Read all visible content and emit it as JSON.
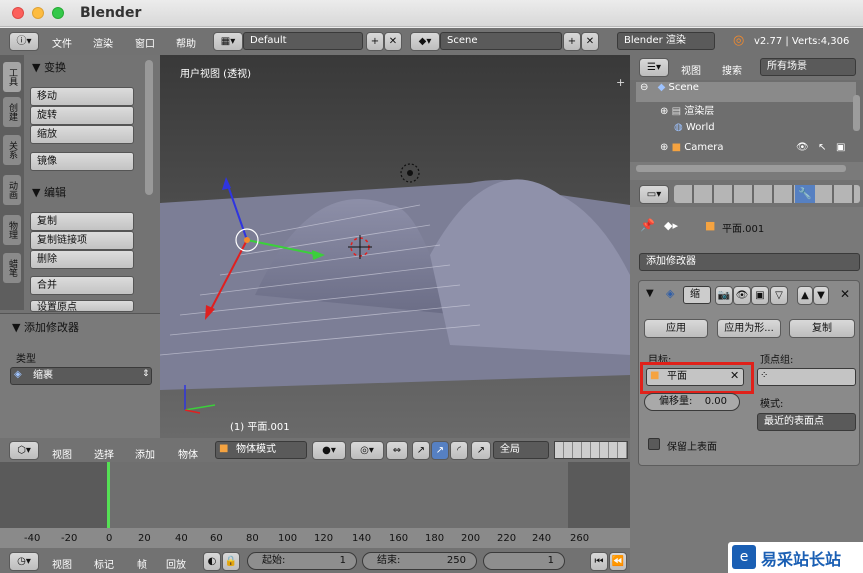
{
  "window": {
    "title": "Blender"
  },
  "top_bar": {
    "menus": [
      "文件",
      "渲染",
      "窗口",
      "帮助"
    ],
    "layout_name": "Default",
    "scene_name": "Scene",
    "render_engine": "Blender 渲染",
    "version_info": "v2.77 | Verts:4,306"
  },
  "tool_shelf": {
    "tabs": [
      "工具",
      "创建",
      "关系",
      "动画",
      "物理",
      "蜡笔"
    ],
    "transform_header": "▼ 变换",
    "transform_buttons": [
      "移动",
      "旋转",
      "缩放",
      "镜像"
    ],
    "edit_header": "▼ 编辑",
    "edit_buttons": [
      "复制",
      "复制链接项",
      "删除",
      "合并",
      "设置原点"
    ]
  },
  "operator_panel": {
    "header": "▼ 添加修改器",
    "type_label": "类型",
    "type_value": "缩裹"
  },
  "viewport": {
    "view_label": "用户视图 (透视)",
    "object_label": "(1) 平面.001"
  },
  "view3d_header": {
    "menus": [
      "视图",
      "选择",
      "添加",
      "物体"
    ],
    "mode": "物体模式",
    "orientation": "全局"
  },
  "timeline": {
    "ticks": [
      "-40",
      "-20",
      "0",
      "20",
      "40",
      "60",
      "80",
      "100",
      "120",
      "140",
      "160",
      "180",
      "200",
      "220",
      "240",
      "260"
    ],
    "current_frame_marker": 0
  },
  "timeline_header": {
    "menus": [
      "视图",
      "标记",
      "帧",
      "回放"
    ],
    "start_label": "起始:",
    "start_value": "1",
    "end_label": "结束:",
    "end_value": "250",
    "current_value": "1"
  },
  "outliner": {
    "menus": [
      "视图",
      "搜索"
    ],
    "filter": "所有场景",
    "items": [
      {
        "label": "Scene"
      },
      {
        "label": "渲染层"
      },
      {
        "label": "World"
      },
      {
        "label": "Camera"
      }
    ]
  },
  "properties": {
    "context_object": "平面.001",
    "add_modifier": "添加修改器",
    "modifier_name": "缩",
    "apply_btn": "应用",
    "apply_as_shape_btn": "应用为形...",
    "copy_btn": "复制",
    "target_label": "目标:",
    "target_value": "平面",
    "vertex_group_label": "顶点组:",
    "offset_label": "偏移量:",
    "offset_value": "0.00",
    "mode_label": "模式:",
    "mode_value": "最近的表面点",
    "keep_above_label": "保留上表面"
  },
  "watermark": {
    "text": "易采站长站"
  },
  "colors": {
    "highlight_box": "#e0211a",
    "accent_blue": "#1a5fb4"
  }
}
